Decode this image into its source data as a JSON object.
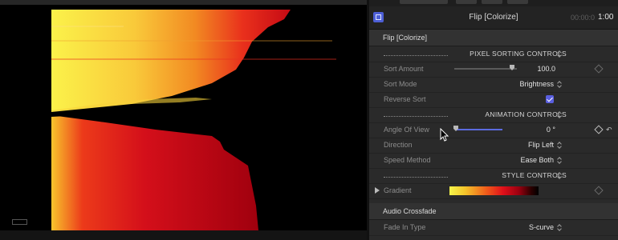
{
  "header": {
    "title": "Flip [Colorize]",
    "timecode_dim": "00:00:0",
    "timecode": "1:00"
  },
  "effect_section": {
    "title": "Flip [Colorize]",
    "pixel_sorting_group": "PIXEL SORTING CONTROLS",
    "sort_amount": {
      "label": "Sort Amount",
      "value": "100.0",
      "level": 1.0
    },
    "sort_mode": {
      "label": "Sort Mode",
      "value": "Brightness"
    },
    "reverse_sort": {
      "label": "Reverse Sort",
      "checked": true
    },
    "animation_group": "ANIMATION CONTROLS",
    "angle_of_view": {
      "label": "Angle Of View",
      "value": "0 °",
      "level": 0.0
    },
    "direction": {
      "label": "Direction",
      "value": "Flip Left"
    },
    "speed_method": {
      "label": "Speed Method",
      "value": "Ease Both"
    },
    "style_group": "STYLE CONTROLS",
    "gradient": {
      "label": "Gradient",
      "colors": [
        "#f5f54a",
        "#ef5a1a",
        "#e0101a",
        "#000000"
      ]
    }
  },
  "audio_section": {
    "title": "Audio Crossfade",
    "fade_in_type": {
      "label": "Fade In Type",
      "value": "S-curve"
    }
  },
  "colors": {
    "accent": "#5b6be0",
    "panel": "#2a2a2a"
  }
}
